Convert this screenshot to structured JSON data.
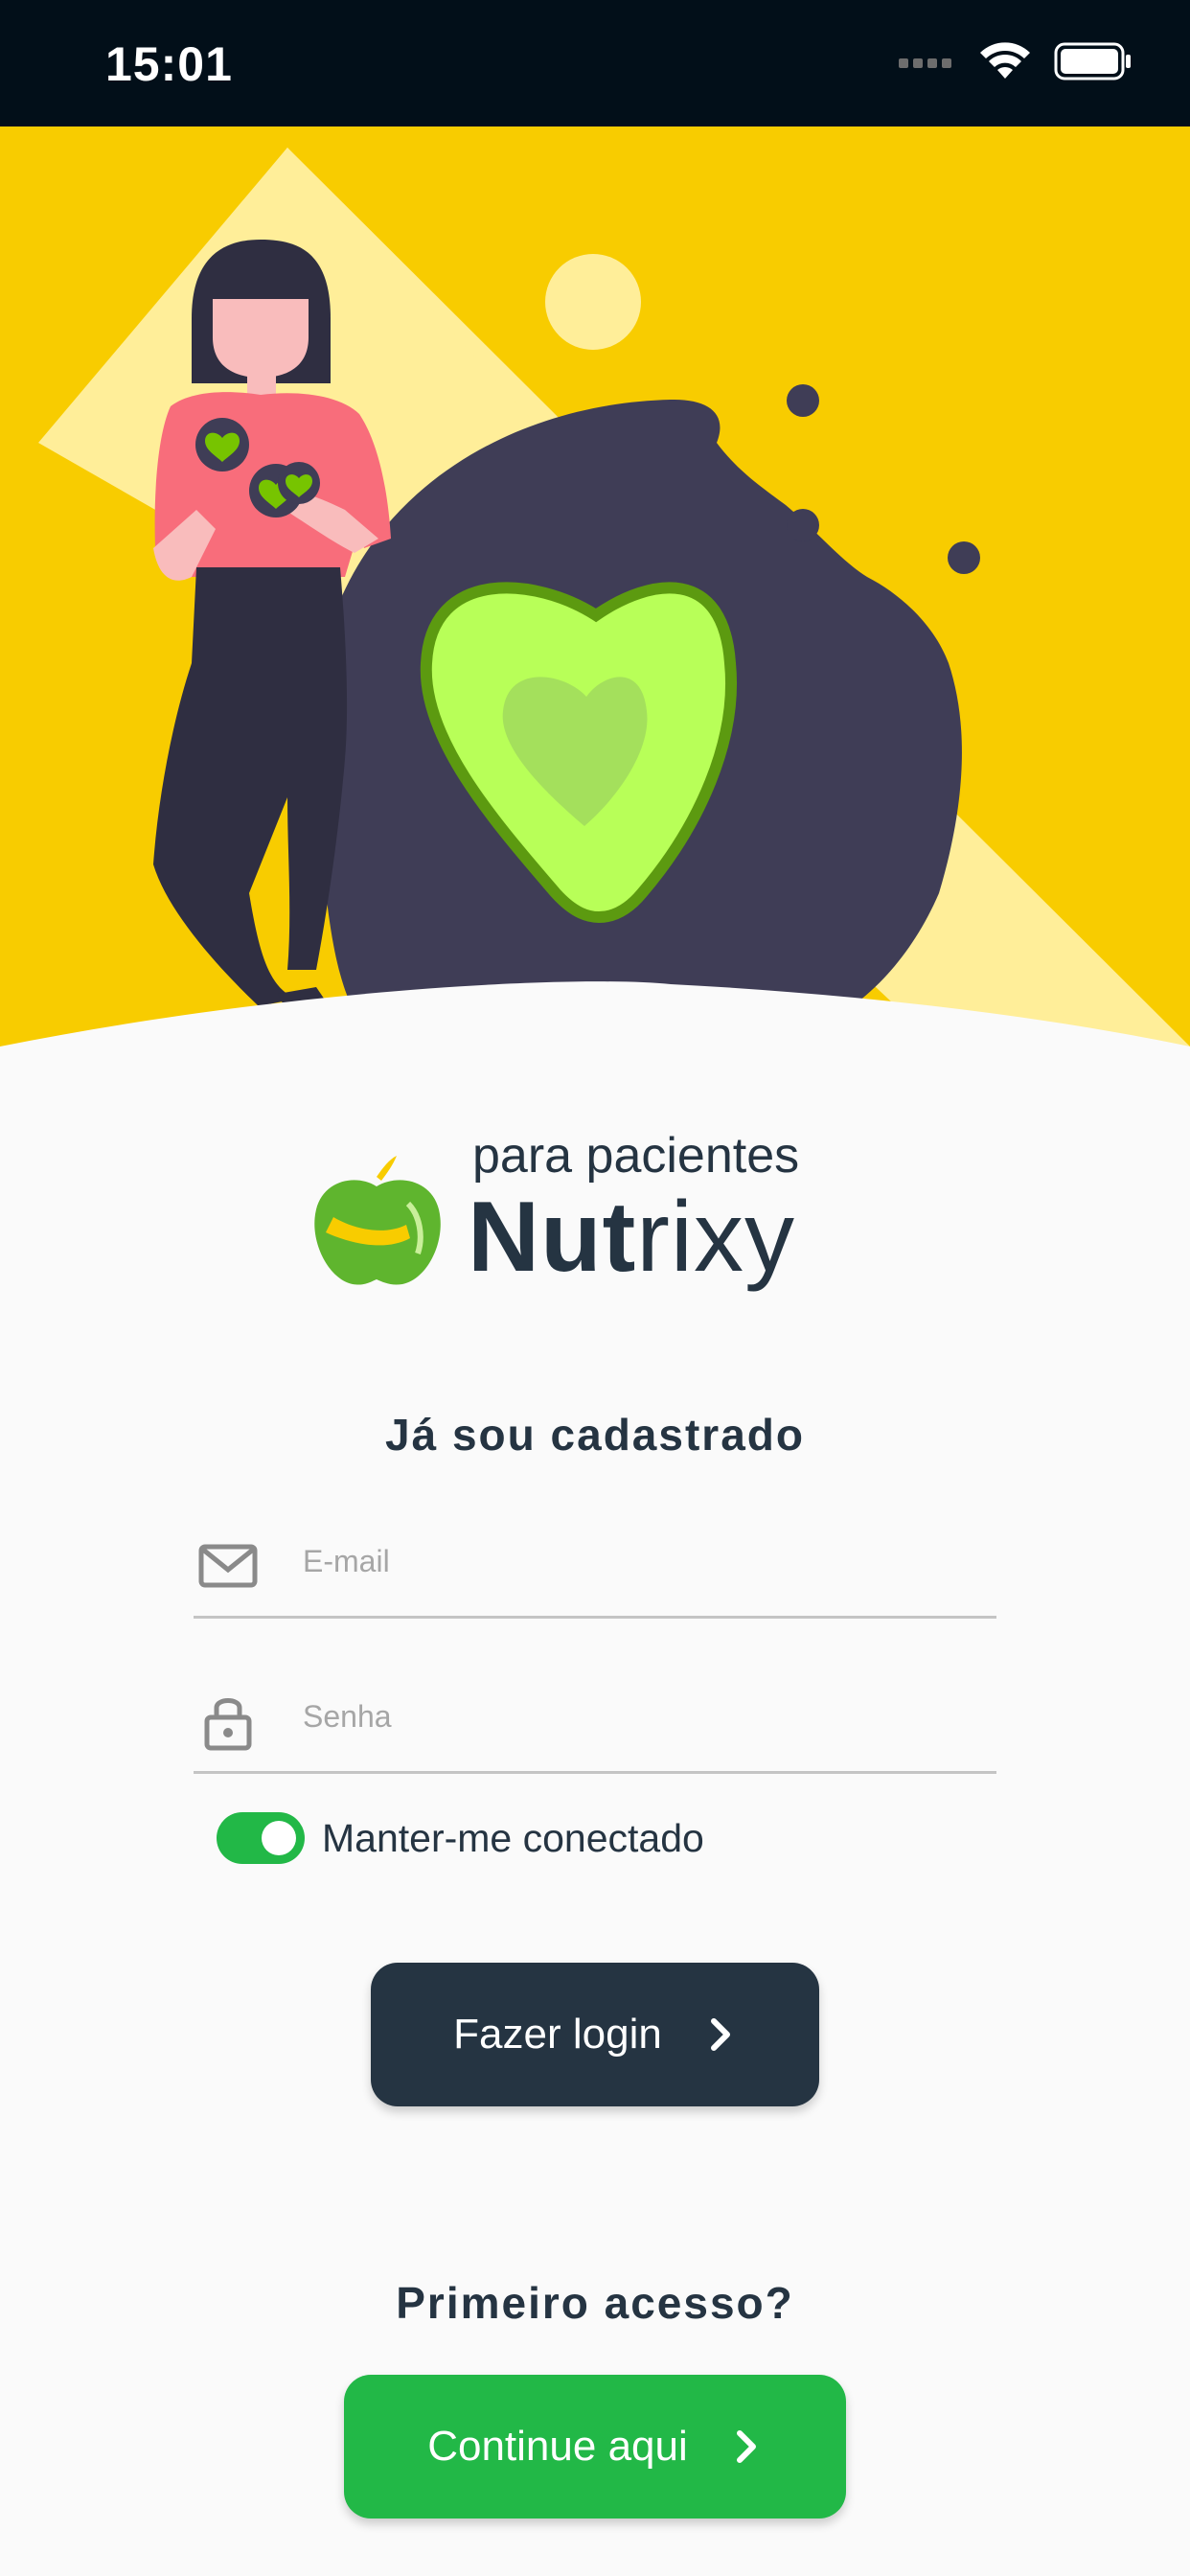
{
  "status_bar": {
    "time": "15:01",
    "icons": [
      "signal-icon",
      "wifi-icon",
      "battery-icon"
    ]
  },
  "colors": {
    "hero_yellow": "#f8cc00",
    "dark_navy": "#253442",
    "brand_green": "#22b847",
    "status_bar_bg": "#020f19",
    "background": "#fafafa"
  },
  "logo": {
    "subtitle": "para pacientes",
    "name_bold": "Nut",
    "name_light": "rixy"
  },
  "login_section": {
    "title": "Já sou cadastrado",
    "email": {
      "placeholder": "E-mail",
      "value": "",
      "icon": "mail-icon"
    },
    "password": {
      "placeholder": "Senha",
      "value": "",
      "icon": "lock-icon"
    },
    "remember_me": {
      "label": "Manter-me conectado",
      "checked": true
    },
    "login_button": {
      "label": "Fazer login",
      "icon": "chevron-right-icon"
    }
  },
  "signup_section": {
    "title": "Primeiro acesso?",
    "continue_button": {
      "label": "Continue aqui",
      "icon": "chevron-right-icon"
    }
  }
}
